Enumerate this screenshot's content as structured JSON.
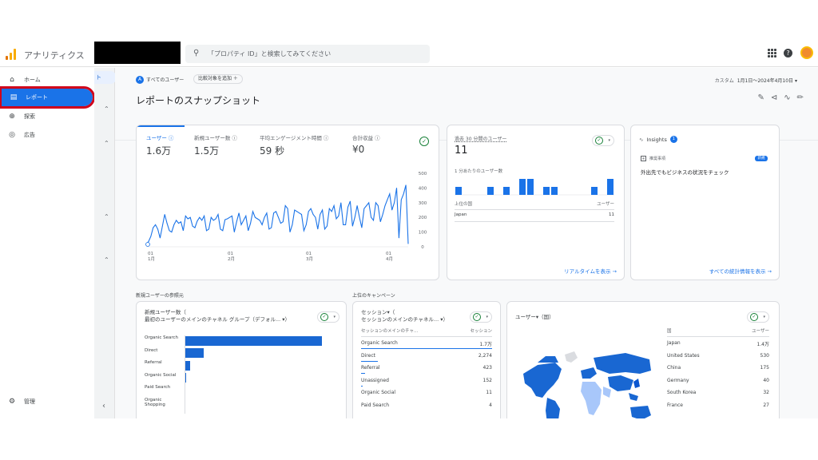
{
  "app": {
    "title": "アナリティクス",
    "search_placeholder": "「プロパティ ID」と検索してみてください"
  },
  "nav": {
    "items": [
      {
        "label": "ホーム",
        "icon": "home-icon"
      },
      {
        "label": "レポート",
        "icon": "reports-icon"
      },
      {
        "label": "探索",
        "icon": "explore-icon"
      },
      {
        "label": "広告",
        "icon": "advertising-icon"
      }
    ],
    "admin": "管理"
  },
  "subnav": {
    "selected": "ト"
  },
  "filters": {
    "all_users": "すべてのユーザー",
    "add_comparison": "比較対象を追加 ＋"
  },
  "date": {
    "label": "カスタム",
    "range": "1月1日～2024年4月10日"
  },
  "page": {
    "title": "レポートのスナップショット"
  },
  "overview": {
    "metrics": [
      {
        "label": "ユーザー ⓘ",
        "value": "1.6万"
      },
      {
        "label": "新規ユーザー数 ⓘ",
        "value": "1.5万"
      },
      {
        "label": "平均エンゲージメント時間 ⓘ",
        "value": "59 秒"
      },
      {
        "label": "合計収益 ⓘ",
        "value": "¥0"
      }
    ],
    "y_ticks": [
      "500",
      "400",
      "300",
      "200",
      "100",
      "0"
    ],
    "x_ticks": [
      {
        "d": "01",
        "m": "1月"
      },
      {
        "d": "01",
        "m": "2月"
      },
      {
        "d": "01",
        "m": "3月"
      },
      {
        "d": "01",
        "m": "4月"
      }
    ]
  },
  "chart_data": {
    "type": "line",
    "ylim": [
      0,
      500
    ],
    "xlabel": "",
    "ylabel": "",
    "x": [
      "01 1月",
      "01 2月",
      "01 3月",
      "01 4月"
    ],
    "values": [
      20,
      35,
      70,
      130,
      150,
      120,
      60,
      140,
      220,
      160,
      110,
      100,
      150,
      180,
      160,
      170,
      110,
      210,
      190,
      200,
      140,
      130,
      175,
      200,
      180,
      210,
      110,
      120,
      200,
      180,
      190,
      220,
      120,
      110,
      185,
      190,
      200,
      210,
      100,
      170,
      230,
      150,
      180,
      210,
      110,
      160,
      240,
      200,
      190,
      180,
      150,
      200,
      230,
      120,
      130,
      230,
      240,
      200,
      160,
      170,
      280,
      260,
      100,
      150,
      250,
      240,
      230,
      220,
      110,
      150,
      240,
      260,
      220,
      200,
      120,
      220,
      250,
      120,
      140,
      260,
      240,
      280,
      190,
      210,
      300,
      150,
      150,
      270,
      310,
      140,
      200,
      280,
      200,
      130,
      260,
      280,
      300,
      200,
      180,
      300,
      280,
      170,
      220,
      280,
      320,
      360,
      250,
      300,
      400,
      60,
      320,
      360,
      420,
      20
    ]
  },
  "realtime": {
    "title": "過去 30 分間のユーザー",
    "value": "11",
    "per_min": "1 分あたりのユーザー数",
    "col1": "上位の国",
    "col2": "ユーザー",
    "rows": [
      {
        "name": "Japan",
        "value": "11"
      }
    ],
    "bars": [
      1,
      0,
      0,
      0,
      1,
      0,
      1,
      0,
      2,
      2,
      0,
      1,
      1,
      0,
      0,
      0,
      0,
      1,
      0,
      2
    ],
    "link": "リアルタイムを表示 →"
  },
  "insights": {
    "title": "Insights",
    "badge": "1",
    "item_label": "推奨事項",
    "new": "新規",
    "text": "外出先でもビジネスの状況をチェック",
    "link": "すべての統計情報を表示 →"
  },
  "new_users": {
    "section": "新規ユーザーの参照元",
    "title1": "新規ユーザー数（",
    "title2": "最初のユーザーのメインのチャネル グループ（デフォル... ▾）",
    "rows": [
      {
        "name": "Organic Search",
        "value": 100
      },
      {
        "name": "Direct",
        "value": 14
      },
      {
        "name": "Referral",
        "value": 4
      },
      {
        "name": "Organic Social",
        "value": 1
      },
      {
        "name": "Paid Search",
        "value": 0.5
      },
      {
        "name": "Organic Shopping",
        "value": 0.3
      }
    ],
    "row_labels": [
      "Organic Search",
      "Direct",
      "Referral",
      "Organic Social",
      "Paid Search",
      "Organic Shopping"
    ]
  },
  "campaigns": {
    "section": "上位のキャンペーン",
    "title1": "セッション▾（",
    "title2": "セッションのメインのチャネル... ▾）",
    "col1": "セッションのメインのチャ...",
    "col2": "セッション",
    "rows": [
      {
        "name": "Organic Search",
        "value": "1.7万"
      },
      {
        "name": "Direct",
        "value": "2,274"
      },
      {
        "name": "Referral",
        "value": "423"
      },
      {
        "name": "Unassigned",
        "value": "152"
      },
      {
        "name": "Organic Social",
        "value": "11"
      },
      {
        "name": "Paid Search",
        "value": "4"
      }
    ],
    "fill": [
      1,
      0.13,
      0.03,
      0.01,
      0,
      0
    ]
  },
  "countries": {
    "title": "ユーザー▾（国）",
    "col1": "国",
    "col2": "ユーザー",
    "rows": [
      {
        "name": "Japan",
        "value": "1.4万"
      },
      {
        "name": "United States",
        "value": "530"
      },
      {
        "name": "China",
        "value": "175"
      },
      {
        "name": "Germany",
        "value": "40"
      },
      {
        "name": "South Korea",
        "value": "32"
      },
      {
        "name": "France",
        "value": "27"
      }
    ]
  },
  "colors": {
    "accent": "#1a73e8",
    "bar": "#1967d2",
    "highlight_box": "#d0021b",
    "logo": "#f9ab00"
  }
}
